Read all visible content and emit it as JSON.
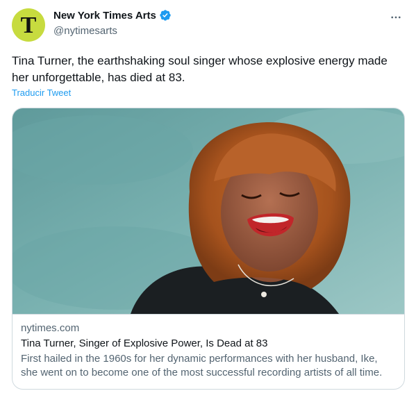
{
  "author": {
    "name": "New York Times Arts",
    "handle": "@nytimesarts",
    "avatar_glyph": "T",
    "avatar_color": "#c7db3f",
    "verified": true,
    "verified_color": "#1d9bf0"
  },
  "tweet": {
    "text": "Tina Turner, the earthshaking soul singer whose explosive energy made her unforgettable, has died at 83.",
    "translate_label": "Traducir Tweet"
  },
  "card": {
    "domain": "nytimes.com",
    "title": "Tina Turner, Singer of Explosive Power, Is Dead at 83",
    "description": "First hailed in the 1960s for her dynamic performances with her husband, Ike, she went on to become one of the most successful recording artists of all time."
  },
  "icons": {
    "more": "more-horizontal-icon",
    "verified": "verified-badge-icon"
  }
}
